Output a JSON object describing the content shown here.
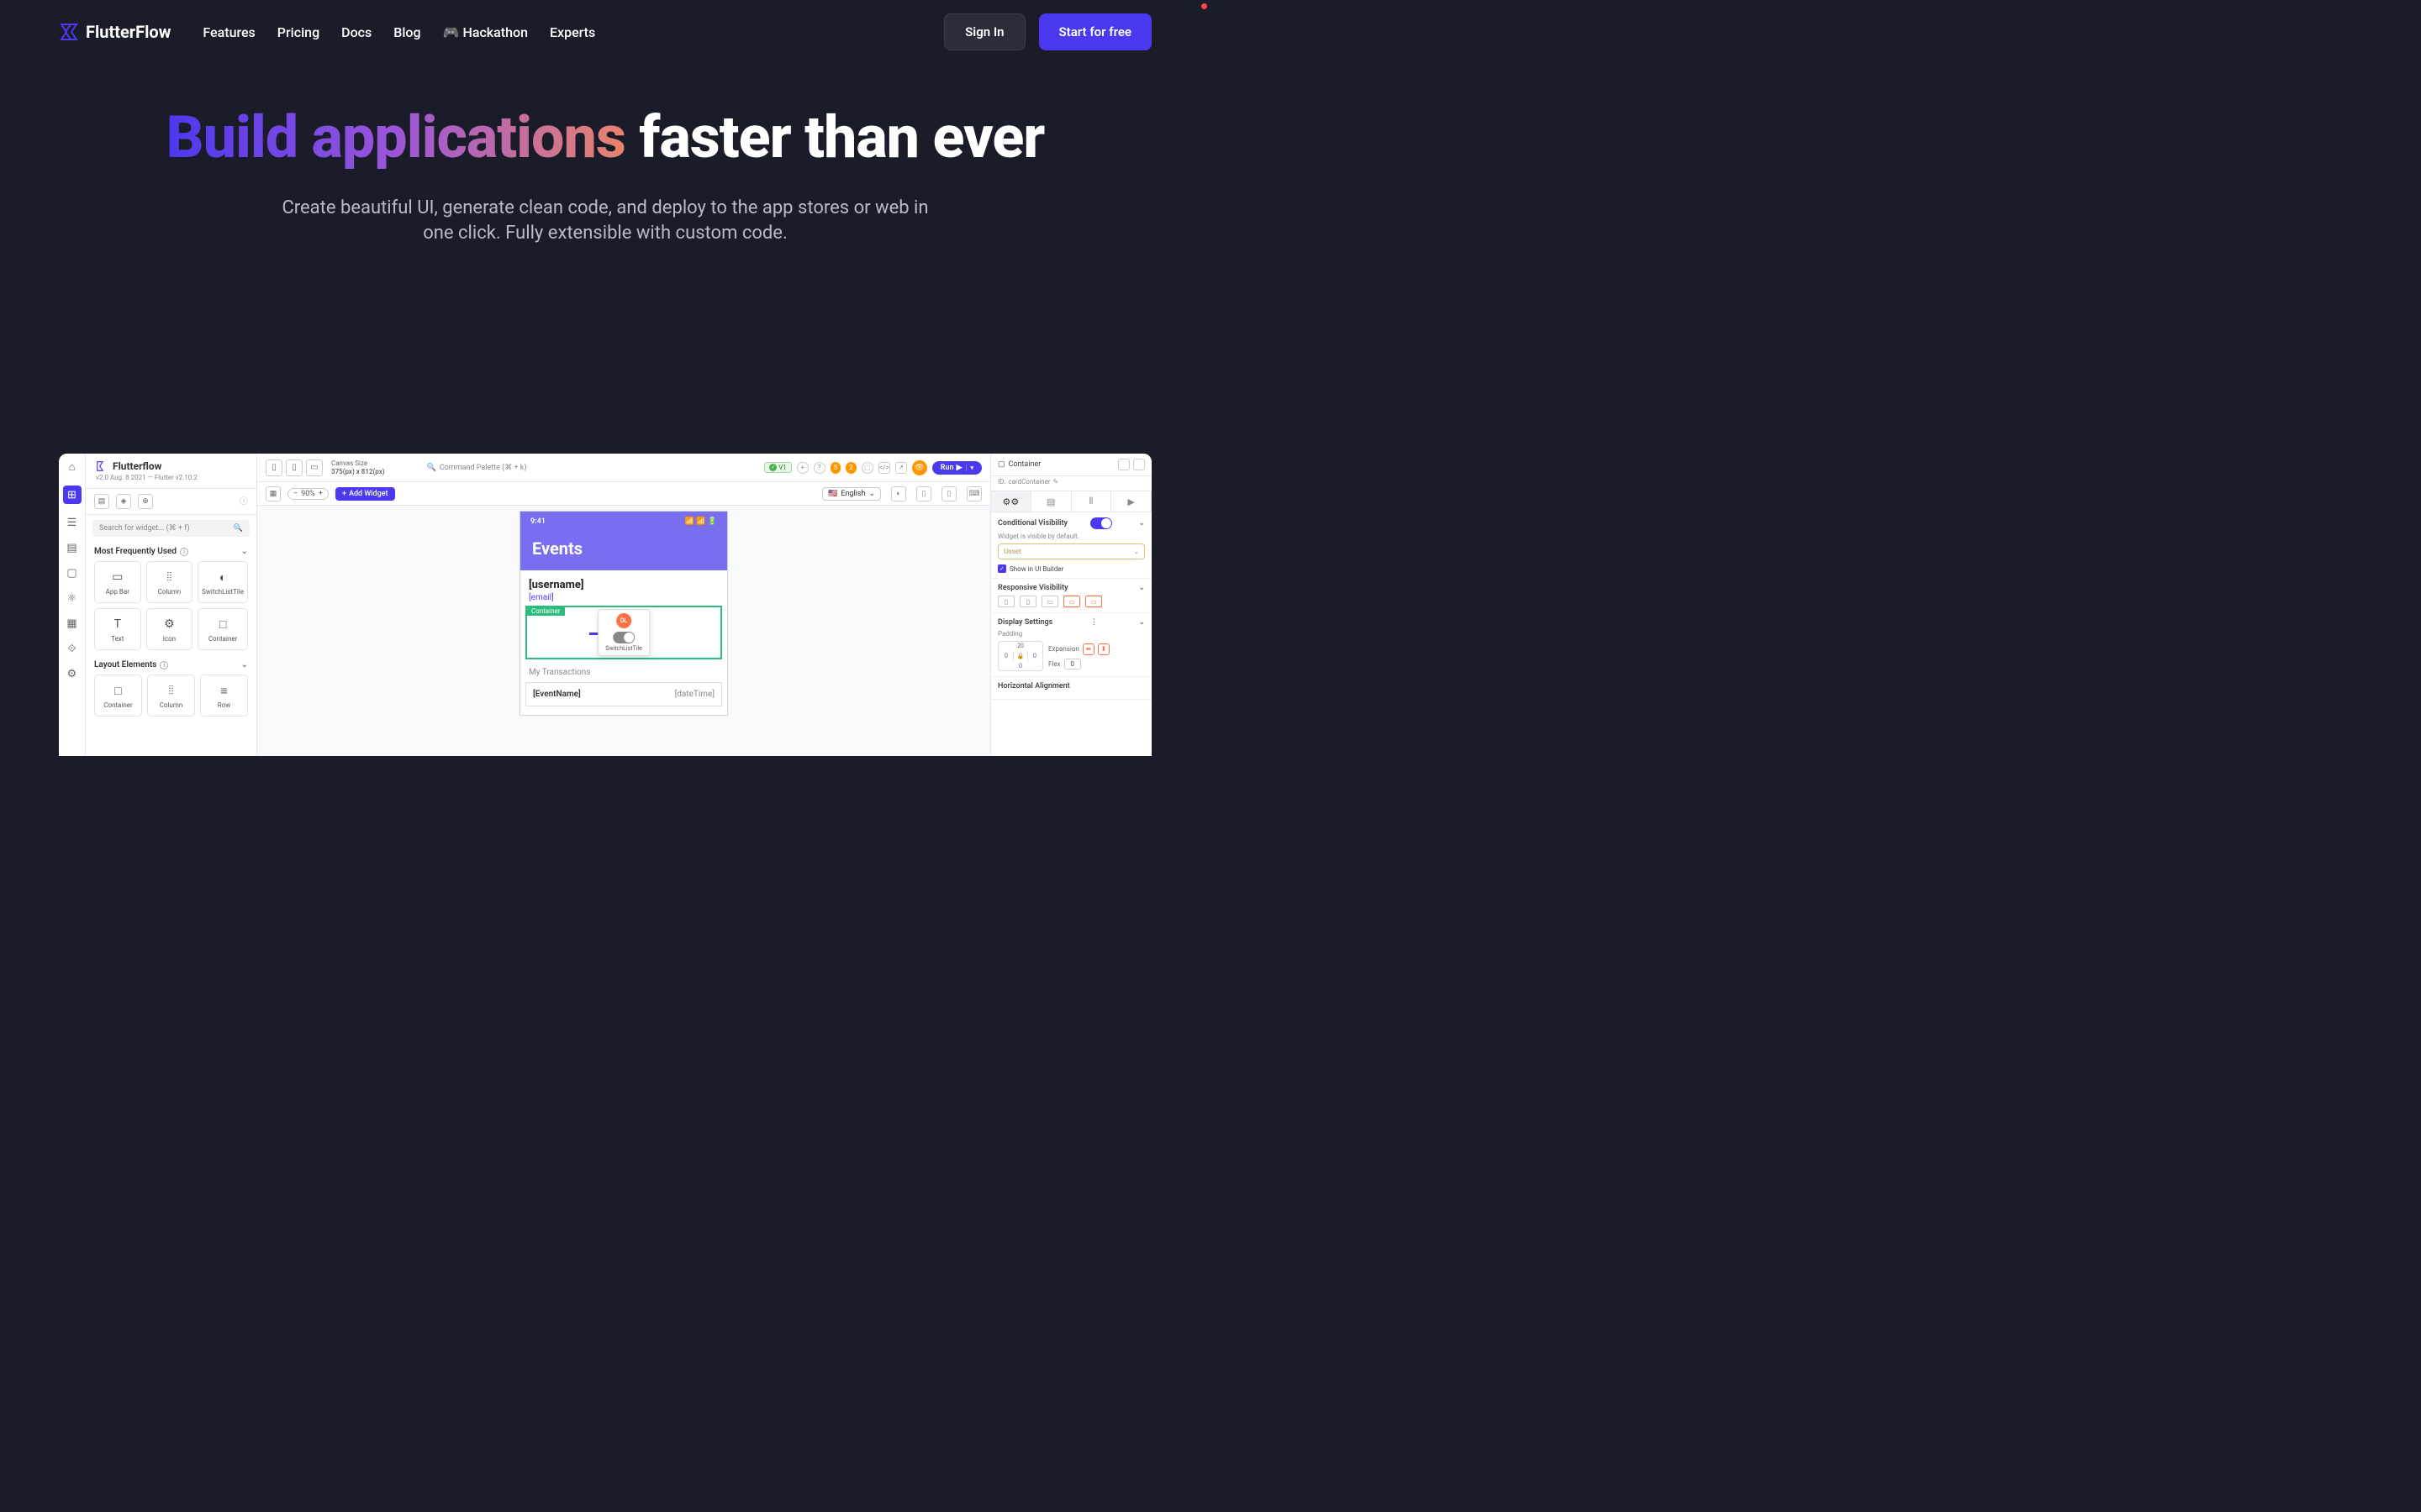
{
  "nav": {
    "brand": "FlutterFlow",
    "links": [
      "Features",
      "Pricing",
      "Docs",
      "Blog",
      "🎮 Hackathon",
      "Experts"
    ],
    "signin": "Sign In",
    "start": "Start for free"
  },
  "hero": {
    "h1a": "Build applications",
    "h1b": "faster than ever",
    "sub": "Create beautiful UI, generate clean code, and deploy to the app stores or web in one click. Fully extensible with custom code."
  },
  "app": {
    "brand": "Flutterflow",
    "version": "v2.0 Aug. 8 2021 — Flutter v2.10.2",
    "search_ph": "Search for widget... (⌘ + f)",
    "sec_freq": "Most Frequently Used",
    "sec_layout": "Layout Elements",
    "widgets_freq": [
      {
        "icon": "▭",
        "label": "App Bar"
      },
      {
        "icon": "⦙⦙",
        "label": "Column"
      },
      {
        "icon": "◐",
        "label": "SwitchListTile"
      },
      {
        "icon": "T",
        "label": "Text"
      },
      {
        "icon": "⚙",
        "label": "Icon"
      },
      {
        "icon": "□",
        "label": "Container"
      }
    ],
    "widgets_layout": [
      {
        "icon": "□",
        "label": "Container"
      },
      {
        "icon": "⦙⦙",
        "label": "Column"
      },
      {
        "icon": "≡",
        "label": "Row"
      }
    ],
    "canvas_label": "Canvas Size",
    "canvas_size": "375(px) x 812(px)",
    "cmd_palette": "Command Palette (⌘ + k)",
    "v_tag": "V1",
    "pill_a": "5",
    "pill_b": "2",
    "run": "Run",
    "zoom": "90%",
    "add_widget": "Add Widget",
    "lang": "English",
    "phone": {
      "time": "9:41",
      "title": "Events",
      "username": "[username]",
      "email": "[email]",
      "container": "Container",
      "switch_av": "DL",
      "switch_label": "SwitchListTile",
      "my_trans": "My Transactions",
      "event": "[EventName]",
      "datetime": "[dateTime]"
    },
    "right": {
      "type": "Container",
      "id_label": "ID:",
      "id": "cardContainer",
      "cond_vis": "Conditional Visibility",
      "cond_sub": "Widget is visible by default.",
      "unset": "Unset",
      "show_builder": "Show in UI Builder",
      "resp_vis": "Responsive Visibility",
      "disp": "Display Settings",
      "padding": "Padding",
      "pad_t": "20",
      "pad_l": "0",
      "pad_r": "0",
      "pad_b": "0",
      "expansion": "Expansion",
      "flex": "Flex",
      "flex_v": "0",
      "halign": "Horizontal Alignment"
    }
  }
}
